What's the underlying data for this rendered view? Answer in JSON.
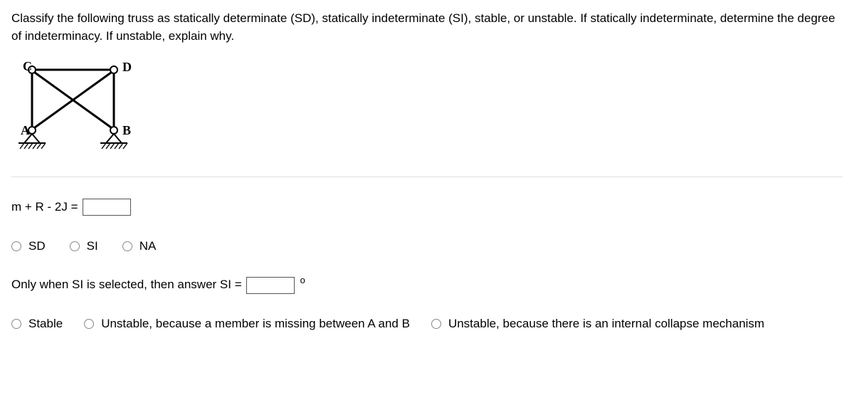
{
  "question": "Classify the following truss as statically determinate (SD), statically indeterminate (SI), stable, or unstable. If statically indeterminate, determine the degree of indeterminacy.  If unstable, explain why.",
  "figure": {
    "labels": {
      "top_left": "C",
      "top_right": "D",
      "bottom_left": "A",
      "bottom_right": "B"
    }
  },
  "eq1": {
    "label": "m + R - 2J =",
    "value": ""
  },
  "group1": {
    "opts": [
      {
        "name": "opt-sd",
        "label": "SD"
      },
      {
        "name": "opt-si",
        "label": "SI"
      },
      {
        "name": "opt-na",
        "label": "NA"
      }
    ]
  },
  "si_followup": {
    "label": "Only when SI is selected, then answer SI =",
    "value": "",
    "degree": "o"
  },
  "group2": {
    "opts": [
      {
        "name": "opt-stable",
        "label": "Stable"
      },
      {
        "name": "opt-unstable-member",
        "label": "Unstable, because a member is missing between A and B"
      },
      {
        "name": "opt-unstable-collapse",
        "label": "Unstable, because there is an internal collapse mechanism"
      }
    ]
  }
}
